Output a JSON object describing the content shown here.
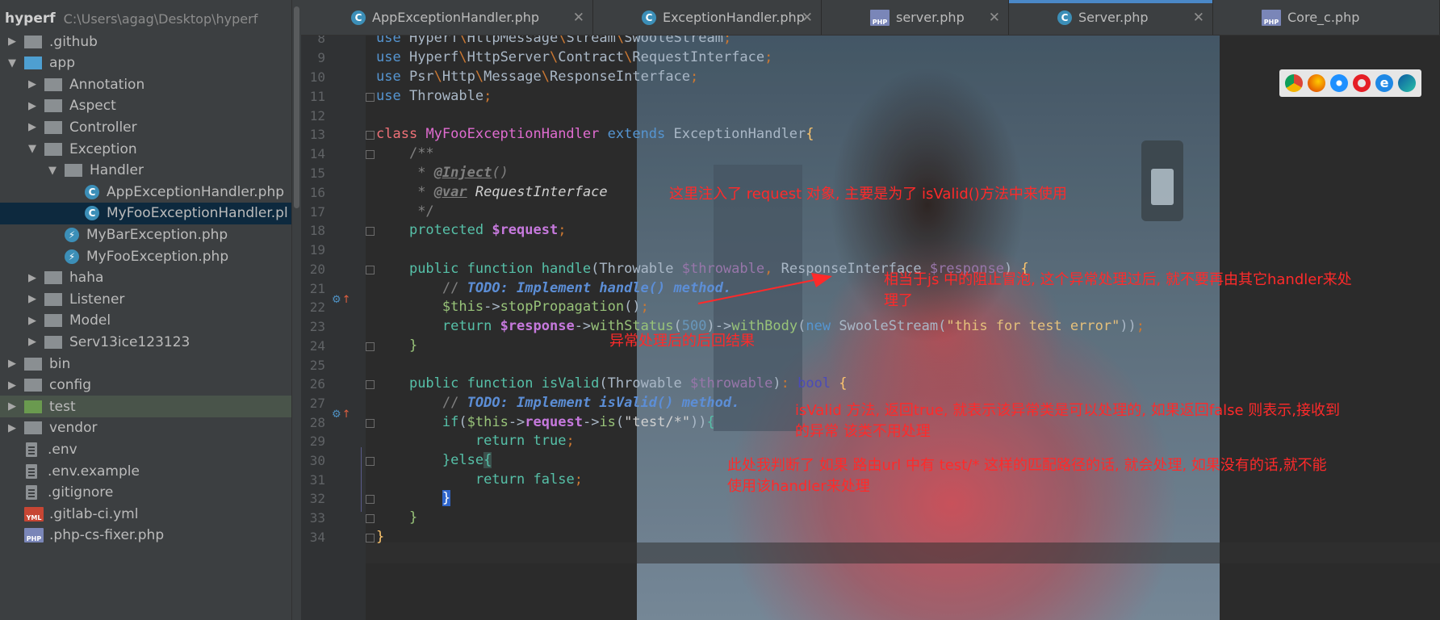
{
  "project": {
    "name": "hyperf",
    "path": "C:\\Users\\agag\\Desktop\\hyperf"
  },
  "tree": [
    {
      "label": ".github",
      "kind": "folder",
      "color": "grey",
      "level": 0,
      "arrow": "right"
    },
    {
      "label": "app",
      "kind": "folder",
      "color": "blue",
      "level": 0,
      "arrow": "down"
    },
    {
      "label": "Annotation",
      "kind": "folder",
      "color": "grey",
      "level": 1,
      "arrow": "right"
    },
    {
      "label": "Aspect",
      "kind": "folder",
      "color": "grey",
      "level": 1,
      "arrow": "right"
    },
    {
      "label": "Controller",
      "kind": "folder",
      "color": "grey",
      "level": 1,
      "arrow": "right"
    },
    {
      "label": "Exception",
      "kind": "folder",
      "color": "grey",
      "level": 1,
      "arrow": "down"
    },
    {
      "label": "Handler",
      "kind": "folder",
      "color": "grey",
      "level": 2,
      "arrow": "down"
    },
    {
      "label": "AppExceptionHandler.php",
      "kind": "class",
      "level": 3
    },
    {
      "label": "MyFooExceptionHandler.pl",
      "kind": "class",
      "level": 3,
      "selected": true
    },
    {
      "label": "MyBarException.php",
      "kind": "exception",
      "level": 2
    },
    {
      "label": "MyFooException.php",
      "kind": "exception",
      "level": 2
    },
    {
      "label": "haha",
      "kind": "folder",
      "color": "grey",
      "level": 1,
      "arrow": "right"
    },
    {
      "label": "Listener",
      "kind": "folder",
      "color": "grey",
      "level": 1,
      "arrow": "right"
    },
    {
      "label": "Model",
      "kind": "folder",
      "color": "grey",
      "level": 1,
      "arrow": "right"
    },
    {
      "label": "Serv13ice123123",
      "kind": "folder",
      "color": "grey",
      "level": 1,
      "arrow": "right"
    },
    {
      "label": "bin",
      "kind": "folder",
      "color": "grey",
      "level": 0,
      "arrow": "right"
    },
    {
      "label": "config",
      "kind": "folder",
      "color": "grey",
      "level": 0,
      "arrow": "right"
    },
    {
      "label": "test",
      "kind": "folder",
      "color": "green",
      "level": 0,
      "arrow": "right",
      "highlight": true
    },
    {
      "label": "vendor",
      "kind": "folder",
      "color": "grey",
      "level": 0,
      "arrow": "right"
    },
    {
      "label": ".env",
      "kind": "file",
      "level": 0
    },
    {
      "label": ".env.example",
      "kind": "file",
      "level": 0
    },
    {
      "label": ".gitignore",
      "kind": "file",
      "level": 0
    },
    {
      "label": ".gitlab-ci.yml",
      "kind": "yml",
      "level": 0
    },
    {
      "label": ".php-cs-fixer.php",
      "kind": "php",
      "level": 0
    }
  ],
  "tabs": [
    {
      "label": "AppExceptionHandler.php",
      "icon": "class"
    },
    {
      "label": "ExceptionHandler.php",
      "icon": "class"
    },
    {
      "label": "server.php",
      "icon": "php"
    },
    {
      "label": "Server.php",
      "icon": "class",
      "active": true
    },
    {
      "label": "Core_c.php",
      "icon": "php"
    }
  ],
  "tab_close": "✕",
  "icon_letters": {
    "class": "C",
    "php": "PHP",
    "yml": "YML"
  },
  "line_numbers": [
    "8",
    "9",
    "10",
    "11",
    "12",
    "13",
    "14",
    "15",
    "16",
    "17",
    "18",
    "19",
    "20",
    "21",
    "22",
    "23",
    "24",
    "25",
    "26",
    "27",
    "28",
    "29",
    "30",
    "31",
    "32",
    "33",
    "34"
  ],
  "annotations": {
    "inject": "这里注入了 request 对象, 主要是为了 isValid()方法中来使用",
    "stop_line1": "相当于js 中的阻止冒泡, 这个异常处理过后, 就不要再由其它handler来处",
    "stop_line2": "理了",
    "result": "异常处理后的后回结果",
    "isvalid_line1": "isValid 方法, 返回true,  就表示该异常类是可以处理的, 如果返回false 则表示,接收到",
    "isvalid_line2": "的异常 该类不用处理",
    "route_line1": "此处我判断了  如果 路由url 中有 test/*  这样的匹配路径的话, 就会处理, 如果没有的话,就不能",
    "route_line2": "使用该handler来处理"
  },
  "colors": {
    "annotation": "#ff2a2a",
    "selection": "#0d293e",
    "accent": "#4a88c7"
  }
}
